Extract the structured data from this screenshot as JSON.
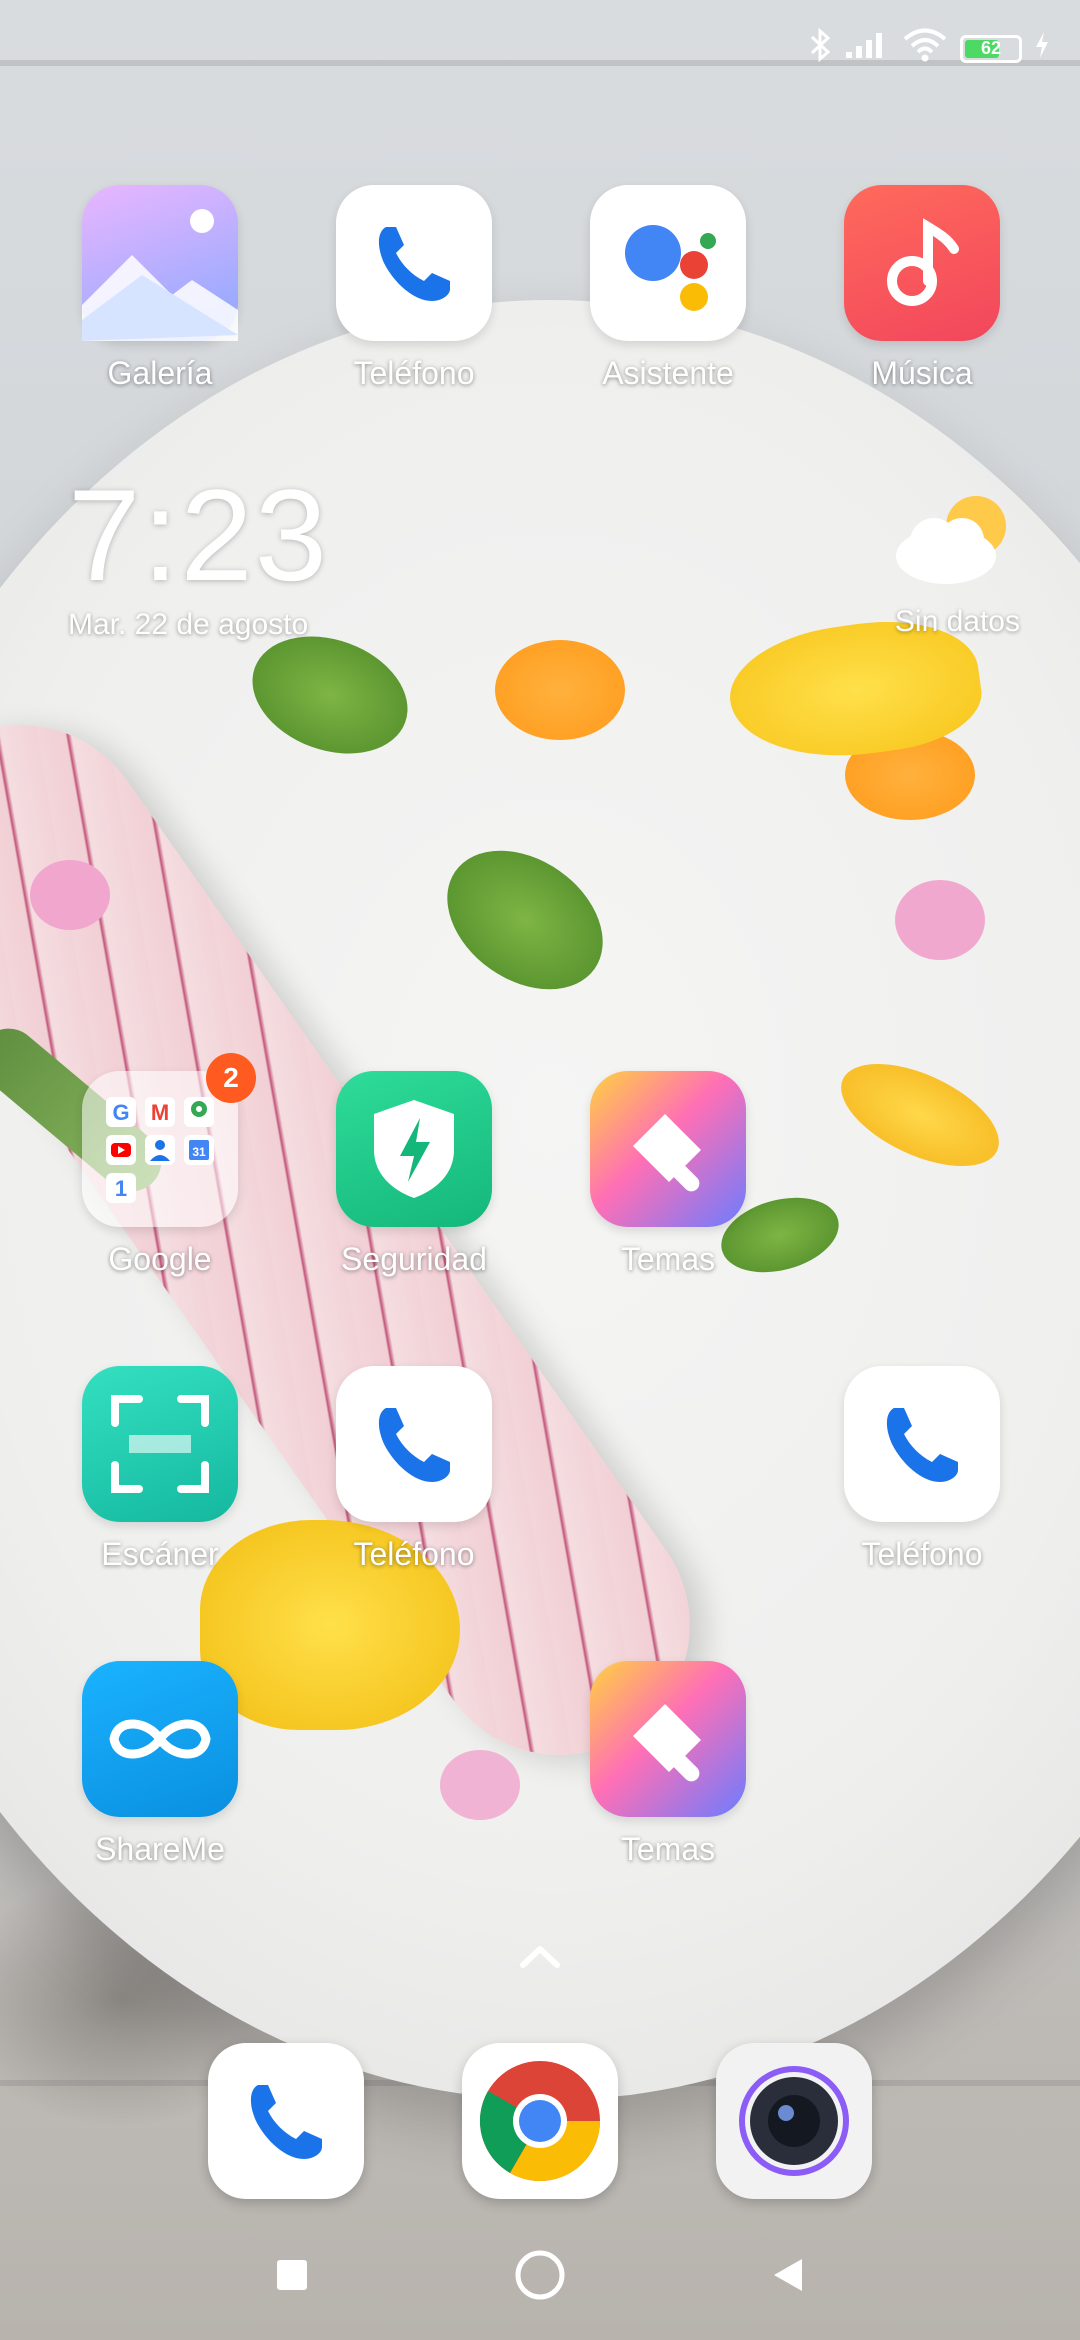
{
  "status_bar": {
    "battery_level": "62",
    "icons": [
      "bluetooth-icon",
      "signal-icon",
      "wifi-icon",
      "battery-icon",
      "charging-icon"
    ]
  },
  "clock_widget": {
    "time": "7:23",
    "date": "Mar. 22 de agosto"
  },
  "weather_widget": {
    "label": "Sin datos",
    "icon": "partly-cloudy-icon"
  },
  "apps": {
    "galeria": "Galería",
    "telefono_1": "Teléfono",
    "asistente": "Asistente",
    "musica": "Música",
    "google": "Google",
    "google_badge": "2",
    "seguridad": "Seguridad",
    "temas_1": "Temas",
    "escaner": "Escáner",
    "telefono_2": "Teléfono",
    "telefono_3": "Teléfono",
    "shareme": "ShareMe",
    "temas_2": "Temas"
  },
  "dock": [
    "phone-icon",
    "chrome-icon",
    "camera-icon"
  ],
  "nav": [
    "recents-button",
    "home-button",
    "back-button"
  ],
  "colors": {
    "badge": "#ff5a1f",
    "phone_blue": "#1a73e8",
    "music_red": "#f2465c",
    "security_green": "#22c98a",
    "shareme_blue": "#12a2f0"
  }
}
